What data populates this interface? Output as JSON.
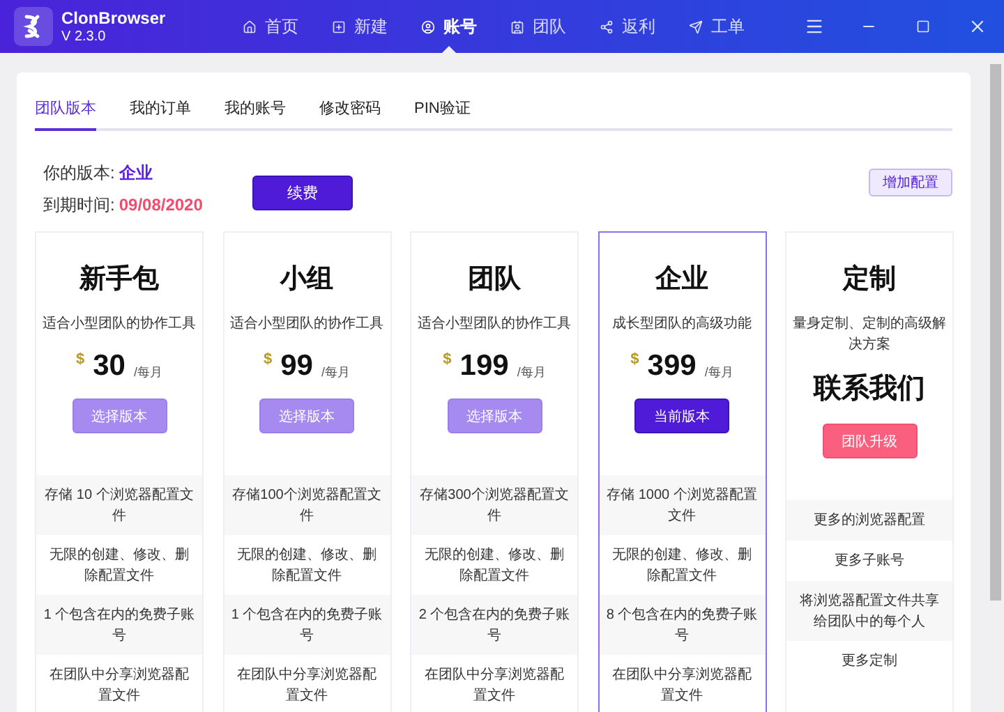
{
  "app": {
    "name": "ClonBrowser",
    "version": "V 2.3.0"
  },
  "nav": [
    {
      "label": "首页",
      "selected": false
    },
    {
      "label": "新建",
      "selected": false
    },
    {
      "label": "账号",
      "selected": true
    },
    {
      "label": "团队",
      "selected": false
    },
    {
      "label": "返利",
      "selected": false
    },
    {
      "label": "工单",
      "selected": false
    }
  ],
  "tabs": [
    {
      "label": "团队版本",
      "selected": true
    },
    {
      "label": "我的订单",
      "selected": false
    },
    {
      "label": "我的账号",
      "selected": false
    },
    {
      "label": "修改密码",
      "selected": false
    },
    {
      "label": "PIN验证",
      "selected": false
    }
  ],
  "summary": {
    "version_label": "你的版本:",
    "version": "企业",
    "expiry_label": "到期时间:",
    "expiry": "09/08/2020",
    "renew_button": "续费",
    "add_config_button": "增加配置"
  },
  "plans": [
    {
      "name": "新手包",
      "description": "适合小型团队的协作工具",
      "kind": "price",
      "currency": "$",
      "price": "30",
      "unit": "/每月",
      "button": {
        "label": "选择版本",
        "kind": "choose"
      },
      "selected": false,
      "features": [
        "存储 10 个浏览器配置文件",
        "无限的创建、修改、删除配置文件",
        "1 个包含在内的免费子账号",
        "在团队中分享浏览器配置文件"
      ]
    },
    {
      "name": "小组",
      "description": "适合小型团队的协作工具",
      "kind": "price",
      "currency": "$",
      "price": "99",
      "unit": "/每月",
      "button": {
        "label": "选择版本",
        "kind": "choose"
      },
      "selected": false,
      "features": [
        "存储100个浏览器配置文件",
        "无限的创建、修改、删除配置文件",
        "1 个包含在内的免费子账号",
        "在团队中分享浏览器配置文件"
      ]
    },
    {
      "name": "团队",
      "description": "适合小型团队的协作工具",
      "kind": "price",
      "currency": "$",
      "price": "199",
      "unit": "/每月",
      "button": {
        "label": "选择版本",
        "kind": "choose"
      },
      "selected": false,
      "features": [
        "存储300个浏览器配置文件",
        "无限的创建、修改、删除配置文件",
        "2 个包含在内的免费子账号",
        "在团队中分享浏览器配置文件"
      ]
    },
    {
      "name": "企业",
      "description": "成长型团队的高级功能",
      "kind": "price",
      "currency": "$",
      "price": "399",
      "unit": "/每月",
      "button": {
        "label": "当前版本",
        "kind": "current"
      },
      "selected": true,
      "features": [
        "存储 1000 个浏览器配置文件",
        "无限的创建、修改、删除配置文件",
        "8 个包含在内的免费子账号",
        "在团队中分享浏览器配置文件"
      ]
    },
    {
      "name": "定制",
      "description": "量身定制、定制的高级解决方案",
      "kind": "contact",
      "contact": "联系我们",
      "button": {
        "label": "团队升级",
        "kind": "upgrade"
      },
      "selected": false,
      "features": [
        "更多的浏览器配置",
        "更多子账号",
        "将浏览器配置文件共享给团队中的每个人",
        "更多定制"
      ]
    }
  ]
}
